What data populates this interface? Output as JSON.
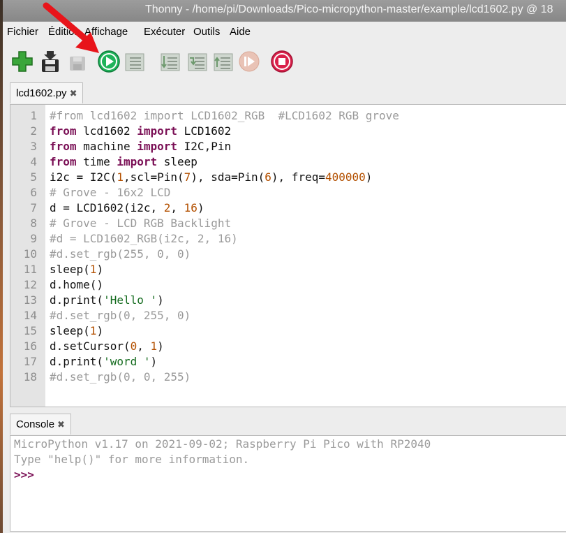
{
  "window": {
    "title": "Thonny  -  /home/pi/Downloads/Pico-micropython-master/example/lcd1602.py  @  18"
  },
  "menu": [
    "Fichier",
    "Édition",
    "Affichage",
    "Exécuter",
    "Outils",
    "Aide"
  ],
  "toolbar": {
    "icons": [
      "new-file-icon",
      "save-file-icon",
      "disabled-save-icon",
      "run-icon",
      "debug-icon",
      "step-over-icon",
      "step-into-icon",
      "step-out-icon",
      "resume-icon",
      "stop-icon"
    ],
    "accent": {
      "run": "#1fb35a",
      "new": "#3aa63a",
      "stop": "#d9204a",
      "arrow": "#e8141a"
    }
  },
  "editor": {
    "tab_label": "lcd1602.py",
    "close_glyph": "✖",
    "line_numbers": [
      "1",
      "2",
      "3",
      "4",
      "5",
      "6",
      "7",
      "8",
      "9",
      "10",
      "11",
      "12",
      "13",
      "14",
      "15",
      "16",
      "17",
      "18"
    ],
    "lines": [
      [
        [
          "cm",
          "#from lcd1602 import LCD1602_RGB  #LCD1602 RGB grove"
        ]
      ],
      [
        [
          "kw",
          "from"
        ],
        [
          "tx",
          " lcd1602 "
        ],
        [
          "kw",
          "import"
        ],
        [
          "tx",
          " LCD1602"
        ]
      ],
      [
        [
          "kw",
          "from"
        ],
        [
          "tx",
          " machine "
        ],
        [
          "kw",
          "import"
        ],
        [
          "tx",
          " I2C,Pin"
        ]
      ],
      [
        [
          "kw",
          "from"
        ],
        [
          "tx",
          " time "
        ],
        [
          "kw",
          "import"
        ],
        [
          "tx",
          " sleep"
        ]
      ],
      [
        [
          "tx",
          "i2c = I2C("
        ],
        [
          "nm",
          "1"
        ],
        [
          "tx",
          ",scl=Pin("
        ],
        [
          "nm",
          "7"
        ],
        [
          "tx",
          "), sda=Pin("
        ],
        [
          "nm",
          "6"
        ],
        [
          "tx",
          "), freq="
        ],
        [
          "nm",
          "400000"
        ],
        [
          "tx",
          ")"
        ]
      ],
      [
        [
          "cm",
          "# Grove - 16x2 LCD"
        ]
      ],
      [
        [
          "tx",
          "d = LCD1602(i2c, "
        ],
        [
          "nm",
          "2"
        ],
        [
          "tx",
          ", "
        ],
        [
          "nm",
          "16"
        ],
        [
          "tx",
          ")"
        ]
      ],
      [
        [
          "cm",
          "# Grove - LCD RGB Backlight"
        ]
      ],
      [
        [
          "cm",
          "#d = LCD1602_RGB(i2c, 2, 16)"
        ]
      ],
      [
        [
          "cm",
          "#d.set_rgb(255, 0, 0)"
        ]
      ],
      [
        [
          "tx",
          "sleep("
        ],
        [
          "nm",
          "1"
        ],
        [
          "tx",
          ")"
        ]
      ],
      [
        [
          "tx",
          "d.home()"
        ]
      ],
      [
        [
          "tx",
          "d.print("
        ],
        [
          "st",
          "'Hello '"
        ],
        [
          "tx",
          ")"
        ]
      ],
      [
        [
          "cm",
          "#d.set_rgb(0, 255, 0)"
        ]
      ],
      [
        [
          "tx",
          "sleep("
        ],
        [
          "nm",
          "1"
        ],
        [
          "tx",
          ")"
        ]
      ],
      [
        [
          "tx",
          "d.setCursor("
        ],
        [
          "nm",
          "0"
        ],
        [
          "tx",
          ", "
        ],
        [
          "nm",
          "1"
        ],
        [
          "tx",
          ")"
        ]
      ],
      [
        [
          "tx",
          "d.print("
        ],
        [
          "st",
          "'word '"
        ],
        [
          "tx",
          ")"
        ]
      ],
      [
        [
          "cm",
          "#d.set_rgb(0, 0, 255)"
        ]
      ]
    ]
  },
  "console": {
    "tab_label": "Console",
    "close_glyph": "✖",
    "lines": [
      "MicroPython v1.17 on 2021-09-02; Raspberry Pi Pico with RP2040",
      "Type \"help()\" for more information."
    ],
    "prompt": ">>>"
  }
}
